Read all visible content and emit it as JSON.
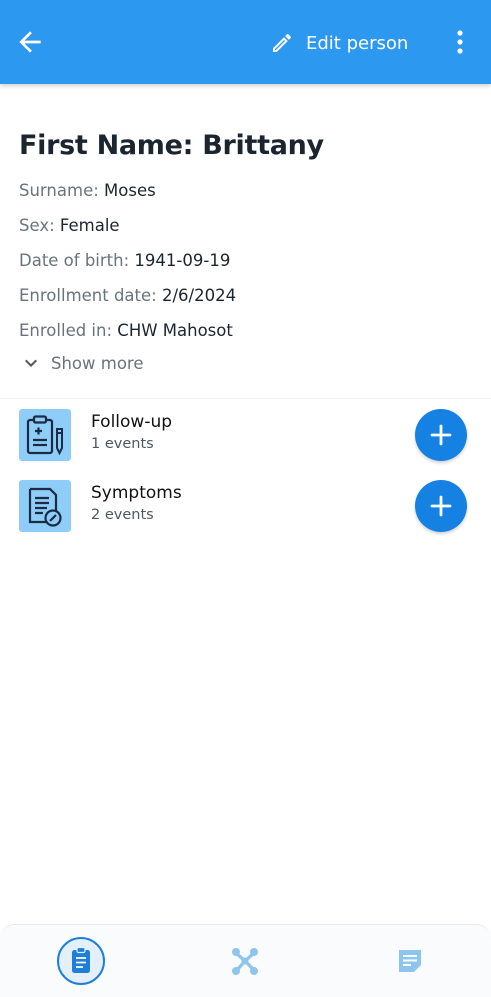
{
  "header": {
    "edit_label": "Edit person",
    "back_icon": "arrow-left-icon",
    "edit_icon": "pencil-icon",
    "more_icon": "more-vertical-icon",
    "bar_color": "#2c98f0"
  },
  "person": {
    "title": "First Name: Brittany",
    "fields": [
      {
        "label": "Surname:",
        "value": "Moses"
      },
      {
        "label": "Sex:",
        "value": "Female"
      },
      {
        "label": "Date of birth:",
        "value": "1941-09-19"
      },
      {
        "label": "Enrollment date:",
        "value": "2/6/2024"
      },
      {
        "label": "Enrolled in:",
        "value": "CHW Mahosot"
      }
    ],
    "show_more_label": "Show more"
  },
  "stages": [
    {
      "name": "Follow-up",
      "count": "1 events",
      "icon": "clipboard-medical-icon"
    },
    {
      "name": "Symptoms",
      "count": "2 events",
      "icon": "document-edit-icon"
    }
  ],
  "bottom_nav": {
    "items": [
      {
        "icon": "assignment-icon",
        "active": true
      },
      {
        "icon": "relationship-network-icon",
        "active": false
      },
      {
        "icon": "notes-icon",
        "active": false
      }
    ]
  },
  "colors": {
    "accent": "#1481e3",
    "icon_bg": "#8ecdf8"
  }
}
